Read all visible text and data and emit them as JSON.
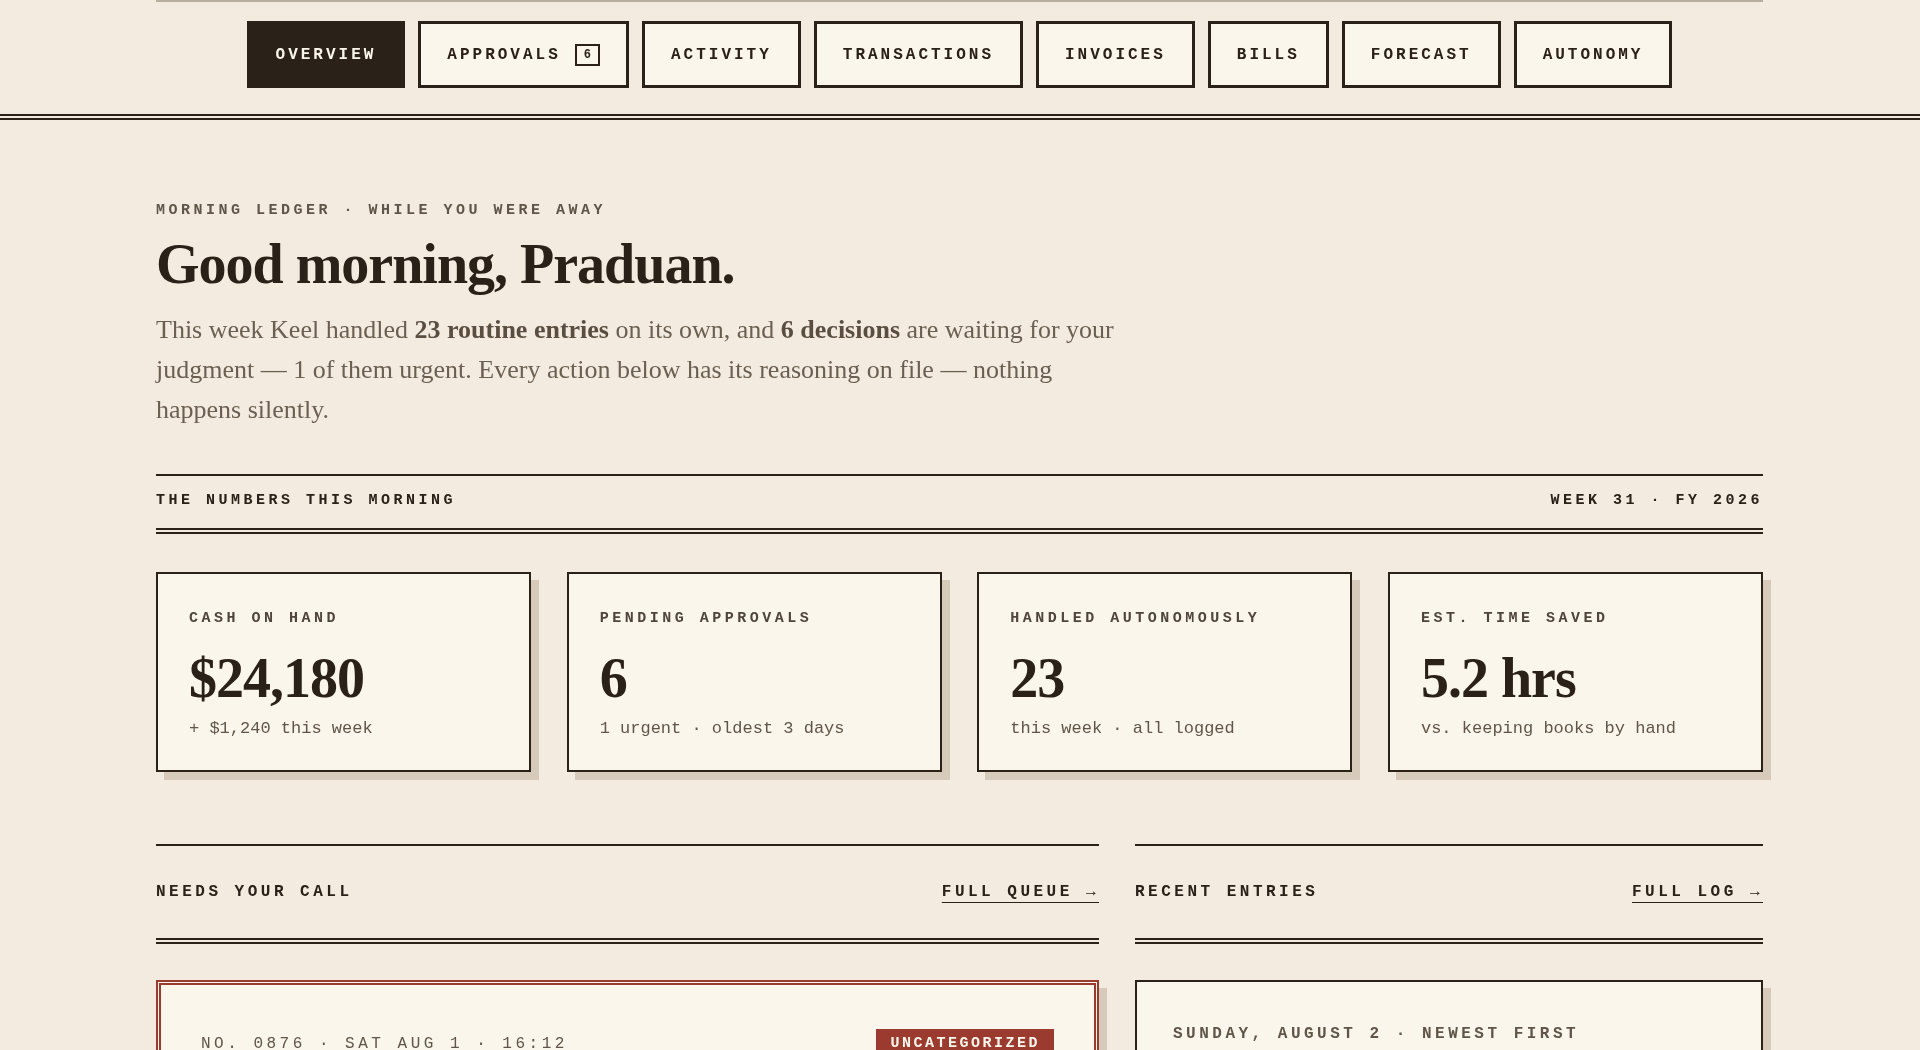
{
  "nav": {
    "tabs": [
      {
        "label": "OVERVIEW",
        "selected": true
      },
      {
        "label": "APPROVALS",
        "selected": false,
        "count": "6"
      },
      {
        "label": "ACTIVITY",
        "selected": false
      },
      {
        "label": "TRANSACTIONS",
        "selected": false
      },
      {
        "label": "INVOICES",
        "selected": false
      },
      {
        "label": "BILLS",
        "selected": false
      },
      {
        "label": "FORECAST",
        "selected": false
      },
      {
        "label": "AUTONOMY",
        "selected": false
      }
    ]
  },
  "intro": {
    "eyebrow": "MORNING LEDGER · WHILE YOU WERE AWAY",
    "heading": "Good morning, Praduan.",
    "summary": "This week Keel handled **23 routine entries** on its own, and **6 decisions** are waiting for your judgment — 1 of them urgent. Every action below has its reasoning on file — nothing happens silently."
  },
  "numbers": {
    "title": "THE NUMBERS THIS MORNING",
    "period": "WEEK 31 · FY 2026",
    "stats": [
      {
        "label": "CASH ON HAND",
        "value": "$24,180",
        "note": "+ $1,240 this week"
      },
      {
        "label": "PENDING APPROVALS",
        "value": "6",
        "note": "1 urgent · oldest 3 days"
      },
      {
        "label": "HANDLED AUTONOMOUSLY",
        "value": "23",
        "note": "this week · all logged"
      },
      {
        "label": "EST. TIME SAVED",
        "value": "5.2 hrs",
        "note": "vs. keeping books by hand"
      }
    ]
  },
  "needs_your_call": {
    "title": "NEEDS YOUR CALL",
    "link": "FULL QUEUE →",
    "items": [
      {
        "meta": "NO. 0876 · SAT AUG 1 · 16:12",
        "tag": "UNCATEGORIZED",
        "urgent": true
      }
    ]
  },
  "recent_entries": {
    "title": "RECENT ENTRIES",
    "link": "FULL LOG →",
    "day": "SUNDAY, AUGUST 2 · NEWEST FIRST"
  }
}
